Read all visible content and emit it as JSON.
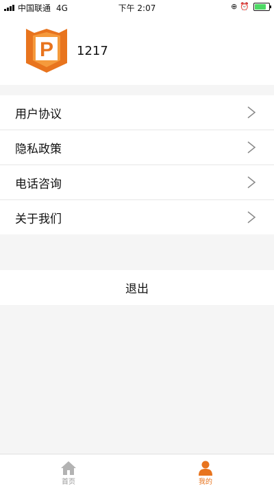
{
  "status_bar": {
    "carrier": "中国联通",
    "network": "4G",
    "time": "下午 2:07"
  },
  "profile": {
    "username": "1217",
    "logo_letter": "P",
    "logo_color": "#e8741e"
  },
  "menu": {
    "items": [
      {
        "label": "用户协议",
        "icon": "chevron-right-icon"
      },
      {
        "label": "隐私政策",
        "icon": "chevron-right-icon"
      },
      {
        "label": "电话咨询",
        "icon": "chevron-right-icon"
      },
      {
        "label": "关于我们",
        "icon": "chevron-right-icon"
      }
    ]
  },
  "logout": {
    "label": "退出"
  },
  "tabbar": {
    "tabs": [
      {
        "label": "首页",
        "icon": "home-icon",
        "active": false
      },
      {
        "label": "我的",
        "icon": "person-icon",
        "active": true
      }
    ],
    "active_color": "#e8741e",
    "inactive_color": "#999999"
  }
}
